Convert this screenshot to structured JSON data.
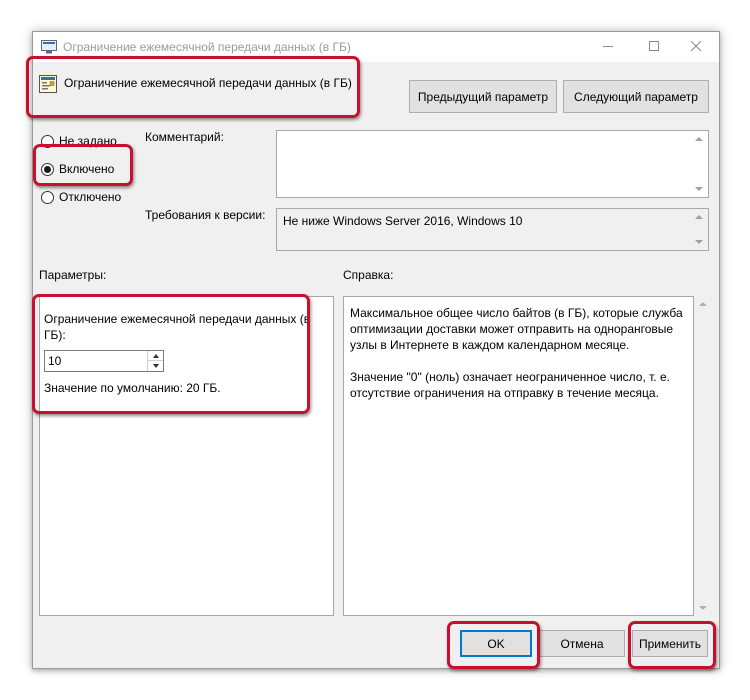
{
  "window": {
    "title": "Ограничение ежемесячной передачи данных (в ГБ)",
    "controls": {
      "minimize": "minimize-icon",
      "maximize": "maximize-icon",
      "close": "close-icon"
    }
  },
  "policy": {
    "title": "Ограничение ежемесячной передачи данных (в ГБ)",
    "prev_button": "Предыдущий параметр",
    "next_button": "Следующий параметр"
  },
  "state": {
    "options": [
      {
        "label": "Не задано",
        "checked": false
      },
      {
        "label": "Включено",
        "checked": true
      },
      {
        "label": "Отключено",
        "checked": false
      }
    ]
  },
  "comment": {
    "label": "Комментарий:",
    "value": ""
  },
  "version": {
    "label": "Требования к версии:",
    "value": "Не ниже Windows Server 2016, Windows 10"
  },
  "params": {
    "label": "Параметры:",
    "field_label": "Ограничение ежемесячной передачи данных (в ГБ):",
    "value": "10",
    "default_text": "Значение по умолчанию: 20 ГБ."
  },
  "help": {
    "label": "Справка:",
    "paragraphs": [
      "Максимальное общее число байтов (в ГБ), которые служба оптимизации доставки может отправить на одноранговые узлы в Интернете в каждом календарном месяце.",
      "Значение \"0\" (ноль) означает неограниченное число, т. е. отсутствие ограничения на отправку в течение месяца."
    ]
  },
  "buttons": {
    "ok": "OK",
    "cancel": "Отмена",
    "apply": "Применить"
  },
  "colors": {
    "highlight": "#c8102e",
    "focus": "#0078d7",
    "dialog_bg": "#f0f0f0"
  }
}
